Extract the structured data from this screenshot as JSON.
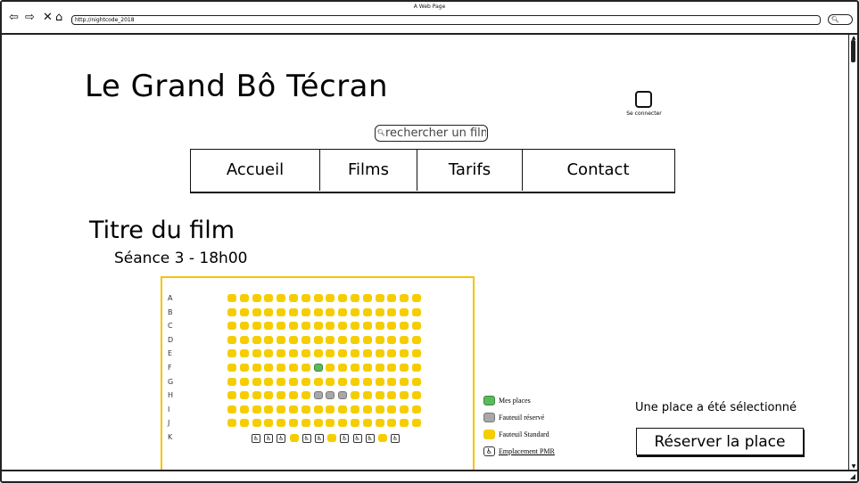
{
  "browser": {
    "window_title": "A Web Page",
    "url": "http://nightcode_2018",
    "search_placeholder": ""
  },
  "header": {
    "site_title": "Le Grand Bô Técran",
    "login_label": "Se connecter",
    "film_search_placeholder": "rechercher un film"
  },
  "nav": {
    "items": [
      {
        "label": "Accueil"
      },
      {
        "label": "Films"
      },
      {
        "label": "Tarifs"
      },
      {
        "label": "Contact"
      }
    ]
  },
  "film": {
    "title": "Titre du film",
    "seance": "Séance 3  -  18h00"
  },
  "seating": {
    "rows": [
      "A",
      "B",
      "C",
      "D",
      "E",
      "F",
      "G",
      "H",
      "I",
      "J",
      "K"
    ],
    "seats_per_row": 16,
    "my_seats": [
      {
        "row": "F",
        "seat": 8
      }
    ],
    "reserved_seats": [
      {
        "row": "H",
        "seat": 8
      },
      {
        "row": "H",
        "seat": 9
      },
      {
        "row": "H",
        "seat": 10
      }
    ],
    "colors": {
      "standard": "#f5cd00",
      "reserved": "#a8a8a8",
      "mine": "#5cb85c",
      "frame": "#f2c500"
    }
  },
  "legend": {
    "mine": "Mes places",
    "reserved": "Fauteuil réservé",
    "standard": "Fauteuil Standard",
    "pmr": "Emplacement PMR"
  },
  "reservation": {
    "status": "Une place a été sélectionné",
    "button": "Réserver la place"
  }
}
